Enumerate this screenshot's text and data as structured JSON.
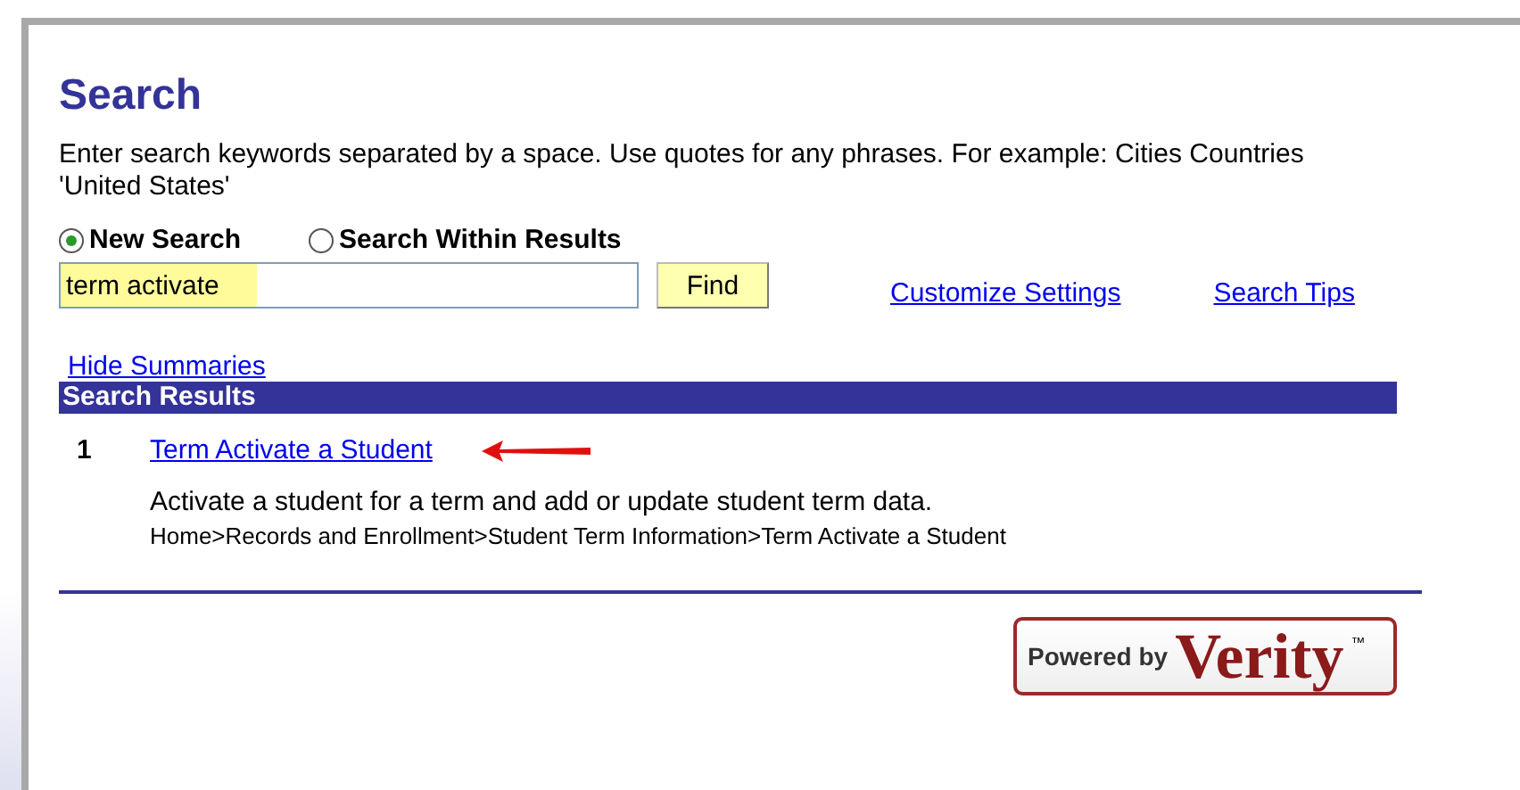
{
  "title": "Search",
  "instructions": "Enter search keywords separated by a space. Use quotes for any phrases. For example: Cities Countries 'United States'",
  "modes": [
    {
      "label": "New Search",
      "selected": true
    },
    {
      "label": "Search Within Results",
      "selected": false
    }
  ],
  "search": {
    "value": "term activate",
    "button": "Find"
  },
  "links": [
    "Customize Settings",
    "Search Tips"
  ],
  "hide_summaries": "Hide Summaries",
  "results_header": "Search Results",
  "results": [
    {
      "number": "1",
      "title": "Term Activate a Student",
      "summary": "Activate a student for a term and add or update student term data.",
      "path": "Home>Records and Enrollment>Student Term Information>Term Activate a Student"
    }
  ],
  "logo": {
    "prefix": "Powered by",
    "brand": "Verity",
    "mark": "™"
  }
}
